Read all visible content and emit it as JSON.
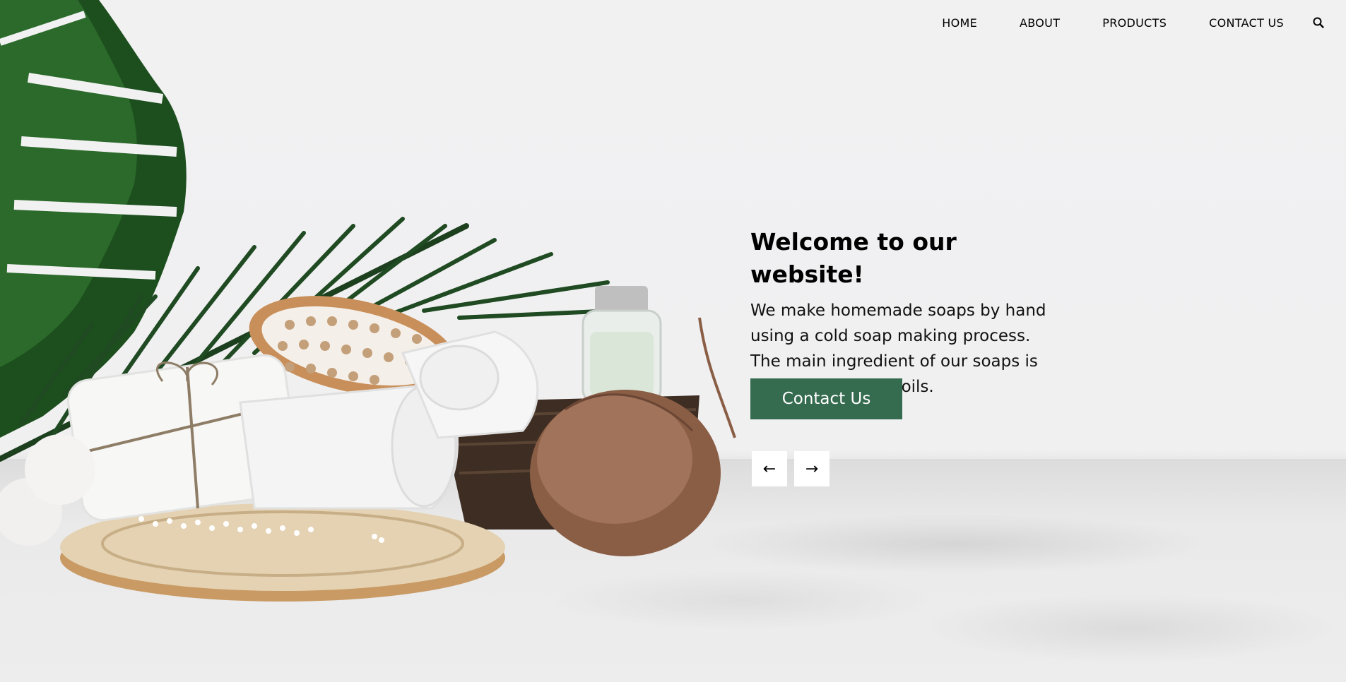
{
  "nav": {
    "items": [
      {
        "label": "HOME"
      },
      {
        "label": "ABOUT"
      },
      {
        "label": "PRODUCTS"
      },
      {
        "label": "CONTACT US"
      }
    ],
    "search_icon": "search-icon"
  },
  "hero": {
    "title": "Welcome to our website!",
    "description": "We make homemade soaps by hand using a cold soap making process. The main ingredient of our soaps is various vegetable oils.",
    "cta_label": "Contact Us",
    "prev_symbol": "←",
    "next_symbol": "→"
  },
  "colors": {
    "accent": "#356b4f",
    "background": "#f1f1f2",
    "text": "#000000"
  }
}
